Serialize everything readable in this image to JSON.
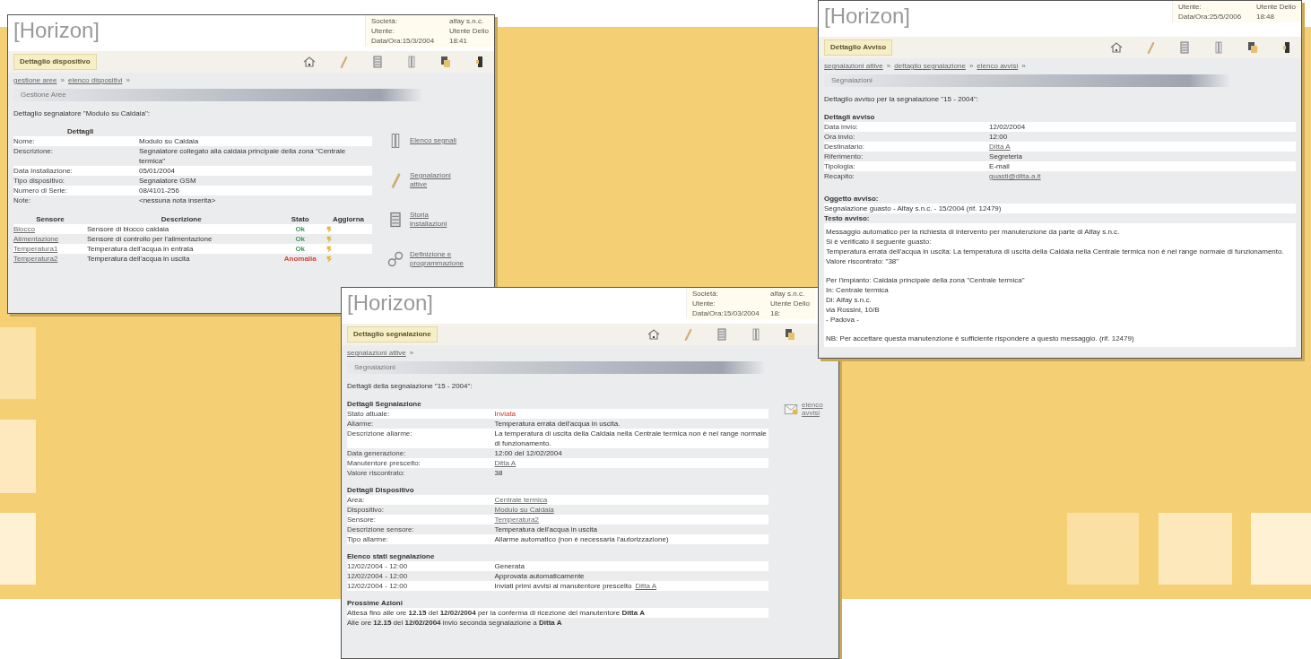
{
  "panels": [
    {
      "logo": "[Horizon]",
      "info": [
        {
          "label": "Società:",
          "value": "alfay s.n.c."
        },
        {
          "label": "Utente:",
          "value": "Utente Delio"
        },
        {
          "label": "Data/Ora:15/3/2004",
          "value": "18:41"
        }
      ],
      "tab": "Dettaglio dispositivo",
      "separator": "»",
      "breadcrumb": [
        "gestione aree",
        "elenco dispositivi"
      ],
      "section": "Gestione Aree",
      "intro": "Dettaglio segnalatore \"Modulo su Caldaia\":",
      "blocks": [
        {
          "kind": "details",
          "title": "Dettagli",
          "rows": [
            {
              "label": "Nome:",
              "value": "Modulo su Caldaia",
              "kind": "text"
            },
            {
              "label": "Descrizione:",
              "value": "Segnalatore collegato alla caldaia principale della zona \"Centrale termica\"",
              "kind": "text"
            },
            {
              "label": "Data Installazione:",
              "value": "05/01/2004",
              "kind": "text"
            },
            {
              "label": "Tipo dispositivo:",
              "value": "Segnalatore GSM",
              "kind": "text"
            },
            {
              "label": "Numero di Serie:",
              "value": "08/4101-256",
              "kind": "text"
            },
            {
              "label": "Note:",
              "value": "<nessuna nota inserita>",
              "kind": "text"
            }
          ]
        },
        {
          "kind": "sensors",
          "columns": [
            "Sensore",
            "Descrizione",
            "Stato",
            "Aggiorna"
          ],
          "rows": [
            {
              "sensor": "Blocco",
              "description": "Sensore di blocco caldaia",
              "status": "Ok",
              "color": "#3a9a5a"
            },
            {
              "sensor": "Alimentazione",
              "description": "Sensore di controllo per l'alimentazione",
              "status": "Ok",
              "color": "#3a9a5a"
            },
            {
              "sensor": "Temperatura1",
              "description": "Temperatura dell'acqua in entrata",
              "status": "Ok",
              "color": "#3a9a5a"
            },
            {
              "sensor": "Temperatura2",
              "description": "Temperatura dell'acqua in uscita",
              "status": "Anomalia",
              "color": "#d0463a"
            }
          ]
        }
      ],
      "side_links": [
        "Elenco segnali",
        "Segnalazioni attive",
        "Storia installazioni",
        "Definizione e programmazione"
      ]
    },
    {
      "logo": "[Horizon]",
      "info": [
        {
          "label": "Utente:",
          "value": "Utente Delio"
        },
        {
          "label": "Data/Ora:25/5/2006",
          "value": "18:48"
        }
      ],
      "tab": "Dettaglio Avviso",
      "separator": "»",
      "breadcrumb": [
        "segnalazioni attive",
        "dettaglio segnalazione",
        "elenco avvisi"
      ],
      "section": "Segnalazioni",
      "intro": "Dettaglio avviso per la segnalazione \"15 - 2004\":",
      "blocks": [
        {
          "kind": "details",
          "title": "Dettagli avviso",
          "rows": [
            {
              "label": "Data invio:",
              "value": "12/02/2004",
              "kind": "text"
            },
            {
              "label": "Ora invio:",
              "value": "12:00",
              "kind": "text"
            },
            {
              "label": "Destinatario:",
              "value": "Ditta A",
              "kind": "link"
            },
            {
              "label": "Riferimento:",
              "value": "Segreteria",
              "kind": "text"
            },
            {
              "label": "Tipologia:",
              "value": "E-mail",
              "kind": "text"
            },
            {
              "label": "Recapito:",
              "value": "guasti@ditta.a.it",
              "kind": "link"
            }
          ]
        },
        {
          "kind": "message",
          "title": "Oggetto avviso:",
          "subject": "Segnalazione guasto - Alfay s.n.c. - 15/2004 (rif. 12479)",
          "body_title": "Testo avviso:",
          "paragraphs": [
            [
              "Messaggio automatico per la richiesta di intervento per manutenzione da parte di Alfay s.n.c.",
              "Si è verificato il seguente guasto:",
              "Temperatura errata dell'acqua in uscita: La temperatura di uscita della Caldaia nella Centrale termica non è nel range normale di funzionamento.",
              "Valore riscontrato: \"38\""
            ],
            [
              "Per l'impianto: Caldaia principale della zona \"Centrale termica\"",
              "In: Centrale termica",
              "Di: Alfay s.n.c.",
              "via Rossini, 10/B",
              "- Padova -"
            ],
            [
              "NB: Per accettare questa manutenzione è sufficiente rispondere a questo messaggio. (rif. 12479)"
            ]
          ]
        }
      ]
    },
    {
      "logo": "[Horizon]",
      "info": [
        {
          "label": "Società:",
          "value": "alfay s.n.c."
        },
        {
          "label": "Utente:",
          "value": "Utente Delio"
        },
        {
          "label": "Data/Ora:15/03/2004",
          "value": "18:"
        }
      ],
      "tab": "Dettaglio segnalazione",
      "separator": "»",
      "breadcrumb": [
        "segnalazioni attive"
      ],
      "section": "Segnalazioni",
      "intro": "Dettagli della segnalazione \"15 - 2004\":",
      "side_icon_link": "elenco avvisi",
      "blocks": [
        {
          "kind": "details",
          "title": "Dettagli Segnalazione",
          "rows": [
            {
              "label": "Stato attuale:",
              "value": "Inviata",
              "kind": "alert"
            },
            {
              "label": "Allarme:",
              "value": "Temperatura errata dell'acqua in uscita.",
              "kind": "text"
            },
            {
              "label": "Descrizione allarme:",
              "value": "La temperatura di uscita della Caldaia nella Centrale termica non è nel range normale di funzionamento.",
              "kind": "text"
            },
            {
              "label": "Data generazione:",
              "value": "12:00 del 12/02/2004",
              "kind": "text"
            },
            {
              "label": "Manutentore prescelto:",
              "value": "Ditta A",
              "kind": "link"
            },
            {
              "label": "Valore riscontrato:",
              "value": "38",
              "kind": "text"
            }
          ]
        },
        {
          "kind": "details",
          "title": "Dettagli Dispositivo",
          "rows": [
            {
              "label": "Area:",
              "value": "Centrale termica",
              "kind": "link"
            },
            {
              "label": "Dispositivo:",
              "value": "Modulo su Caldaia",
              "kind": "link"
            },
            {
              "label": "Sensore:",
              "value": "Temperatura2",
              "kind": "link"
            },
            {
              "label": "Descrizione sensore:",
              "value": "Temperatura dell'acqua in uscita",
              "kind": "text"
            },
            {
              "label": "Tipo allarme:",
              "value": "Allarme automatico (non è necessaria l'autorizzazione)",
              "kind": "text"
            }
          ]
        },
        {
          "kind": "details",
          "title": "Elenco stati segnalazione",
          "rows": [
            {
              "label": "12/02/2004 - 12:00",
              "value": "Generata",
              "kind": "text"
            },
            {
              "label": "12/02/2004 - 12:00",
              "value": "Approvata automaticamente",
              "kind": "text"
            },
            {
              "label": "12/02/2004 - 12:00",
              "value": "Inviati primi avvisi al manutentore prescelto",
              "kind": "text",
              "link": "Ditta A"
            }
          ]
        },
        {
          "kind": "notes",
          "title": "Prossime Azioni",
          "lines": [
            "Attesa fino alle ore **12.15** del **12/02/2004** per la conferma di ricezione del manutentore **Ditta A**",
            "Alle ore **12.15** del **12/02/2004** invio seconda segnalazione a **Ditta A**"
          ]
        }
      ]
    }
  ]
}
